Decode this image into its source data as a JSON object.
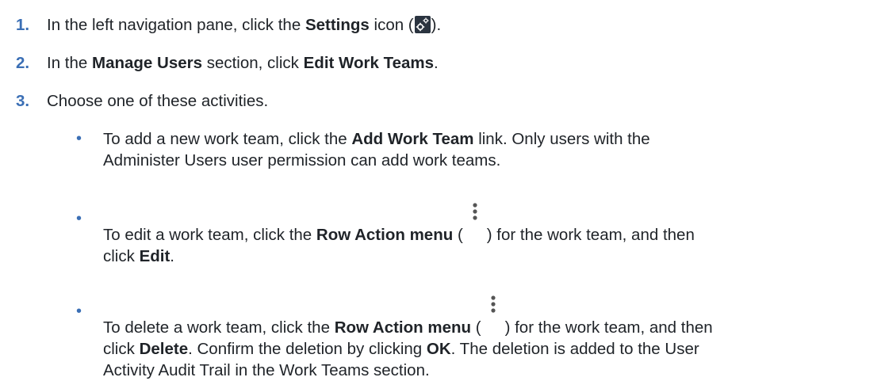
{
  "steps": [
    {
      "number": "1.",
      "parts": [
        "In the left navigation pane, click the ",
        "Settings",
        " icon (",
        ")."
      ]
    },
    {
      "number": "2.",
      "parts": [
        "In the ",
        "Manage Users",
        " section, click ",
        "Edit Work Teams",
        "."
      ]
    },
    {
      "number": "3.",
      "parts": [
        "Choose one of these activities."
      ]
    }
  ],
  "bullets": [
    {
      "line1": [
        "To add a new work team, click the ",
        "Add Work Team",
        " link. Only users with the"
      ],
      "line2": [
        "Administer Users user permission can add work teams."
      ]
    },
    {
      "line1": [
        "To edit a work team, click the ",
        "Row Action menu",
        " (",
        ") for the work team, and then"
      ],
      "line2": [
        "click ",
        "Edit",
        "."
      ]
    },
    {
      "line1": [
        "To delete a work team, click the ",
        "Row Action menu",
        " (",
        ") for the work team, and then"
      ],
      "line2": [
        "click ",
        "Delete",
        ". Confirm the deletion by clicking ",
        "OK",
        ". The deletion is added to the User"
      ],
      "line3": [
        "Activity Audit Trail in the Work Teams section."
      ]
    }
  ],
  "bullet_glyph": "•",
  "icons": {
    "settings": "gear-icon",
    "row_action": "vertical-ellipsis-icon"
  },
  "colors": {
    "accent": "#3b6fb5",
    "text": "#1f2328",
    "icon_bg": "#2b3440"
  }
}
